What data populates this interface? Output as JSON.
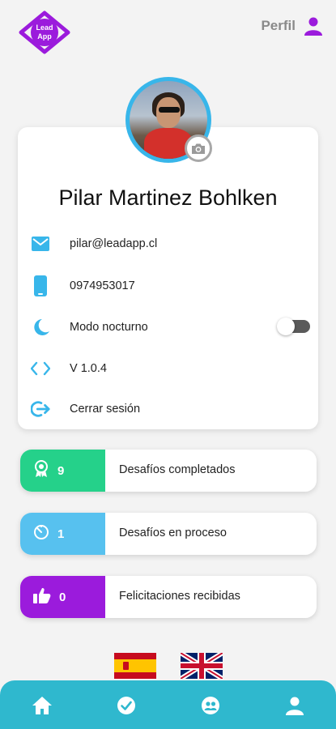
{
  "header": {
    "logo_line1": "Lead",
    "logo_line2": "App",
    "profile_label": "Perfil"
  },
  "colors": {
    "brand_purple": "#9b1bdc",
    "accent_blue": "#38b6ea",
    "green": "#25d18a",
    "light_blue": "#57c1ef",
    "purple": "#9b1bdc",
    "nav_bg": "#2fb8ce"
  },
  "profile": {
    "name": "Pilar Martinez Bohlken",
    "email": "pilar@leadapp.cl",
    "phone": "0974953017",
    "dark_mode_label": "Modo nocturno",
    "dark_mode_on": false,
    "version": "V 1.0.4",
    "logout_label": "Cerrar sesión"
  },
  "stats": [
    {
      "count": "9",
      "label": "Desafíos completados",
      "icon": "medal-icon"
    },
    {
      "count": "1",
      "label": "Desafíos en proceso",
      "icon": "timer-icon"
    },
    {
      "count": "0",
      "label": "Felicitaciones recibidas",
      "icon": "thumbs-up-icon"
    }
  ],
  "languages": [
    "spain-flag",
    "uk-flag"
  ],
  "nav": [
    "home-icon",
    "check-circle-icon",
    "team-icon",
    "person-icon"
  ]
}
